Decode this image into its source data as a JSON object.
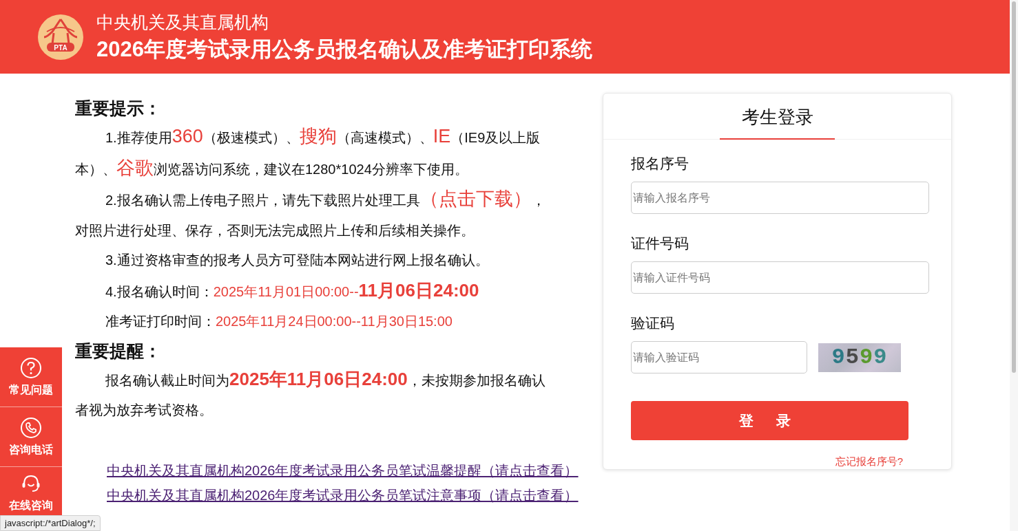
{
  "header": {
    "subtitle": "中央机关及其直属机构",
    "title": "2026年度考试录用公务员报名确认及准考证打印系统",
    "logo_text": "PTA"
  },
  "notice": {
    "heading": "重要提示：",
    "paragraphs": [
      {
        "segments": [
          {
            "kind": "plain",
            "text": "1.推荐使用"
          },
          {
            "kind": "red_large",
            "text": "360"
          },
          {
            "kind": "plain",
            "text": "（极速模式）、"
          },
          {
            "kind": "red_large",
            "text": "搜狗"
          },
          {
            "kind": "plain",
            "text": "（高速模式）、"
          },
          {
            "kind": "red_large",
            "text": "IE"
          },
          {
            "kind": "plain",
            "text": "（IE9及以上版本）、"
          },
          {
            "kind": "red_large",
            "text": "谷歌"
          },
          {
            "kind": "plain",
            "text": "浏览器访问系统，建议在1280*1024分辨率下使用。"
          }
        ]
      },
      {
        "segments": [
          {
            "kind": "plain",
            "text": "2.报名确认需上传电子照片，请先下载照片处理工具"
          },
          {
            "kind": "red_large",
            "text": "（点击下载）"
          },
          {
            "kind": "plain",
            "text": "，对照片进行处理、保存，否则无法完成照片上传和后续相关操作。"
          }
        ]
      },
      {
        "segments": [
          {
            "kind": "plain",
            "text": "3.通过资格审查的报考人员方可登陆本网站进行网上报名确认。"
          }
        ]
      },
      {
        "segments": [
          {
            "kind": "plain",
            "text": "4.报名确认时间："
          },
          {
            "kind": "red",
            "text": "2025年11月01日00:00--"
          },
          {
            "kind": "red_bold",
            "text": "11月06日24:00"
          }
        ]
      },
      {
        "segments": [
          {
            "kind": "plain",
            "text": "准考证打印时间："
          },
          {
            "kind": "red",
            "text": "2025年11月24日00:00--11月30日15:00"
          }
        ]
      }
    ]
  },
  "reminder": {
    "heading": "重要提醒：",
    "paragraphs": [
      {
        "segments": [
          {
            "kind": "plain",
            "text": "报名确认截止时间为"
          },
          {
            "kind": "red_bold",
            "text": "2025年11月06日24:00"
          },
          {
            "kind": "plain",
            "text": "，未按期参加报名确认者视为放弃考试资格。"
          }
        ]
      }
    ]
  },
  "links": [
    "中央机关及其直属机构2026年度考试录用公务员笔试温馨提醒（请点击查看）",
    "中央机关及其直属机构2026年度考试录用公务员笔试注意事项（请点击查看）"
  ],
  "login": {
    "title": "考生登录",
    "fields": [
      {
        "label": "报名序号",
        "placeholder": "请输入报名序号"
      },
      {
        "label": "证件号码",
        "placeholder": "请输入证件号码"
      },
      {
        "label": "验证码",
        "placeholder": "请输入验证码"
      }
    ],
    "captcha": "9599",
    "button": "登 录",
    "forgot": "忘记报名序号?"
  },
  "sidebar": {
    "items": [
      {
        "label": "常见问题"
      },
      {
        "label": "咨询电话"
      },
      {
        "label": "在线咨询"
      }
    ]
  },
  "status_tooltip": "javascript:/*artDialog*/;"
}
